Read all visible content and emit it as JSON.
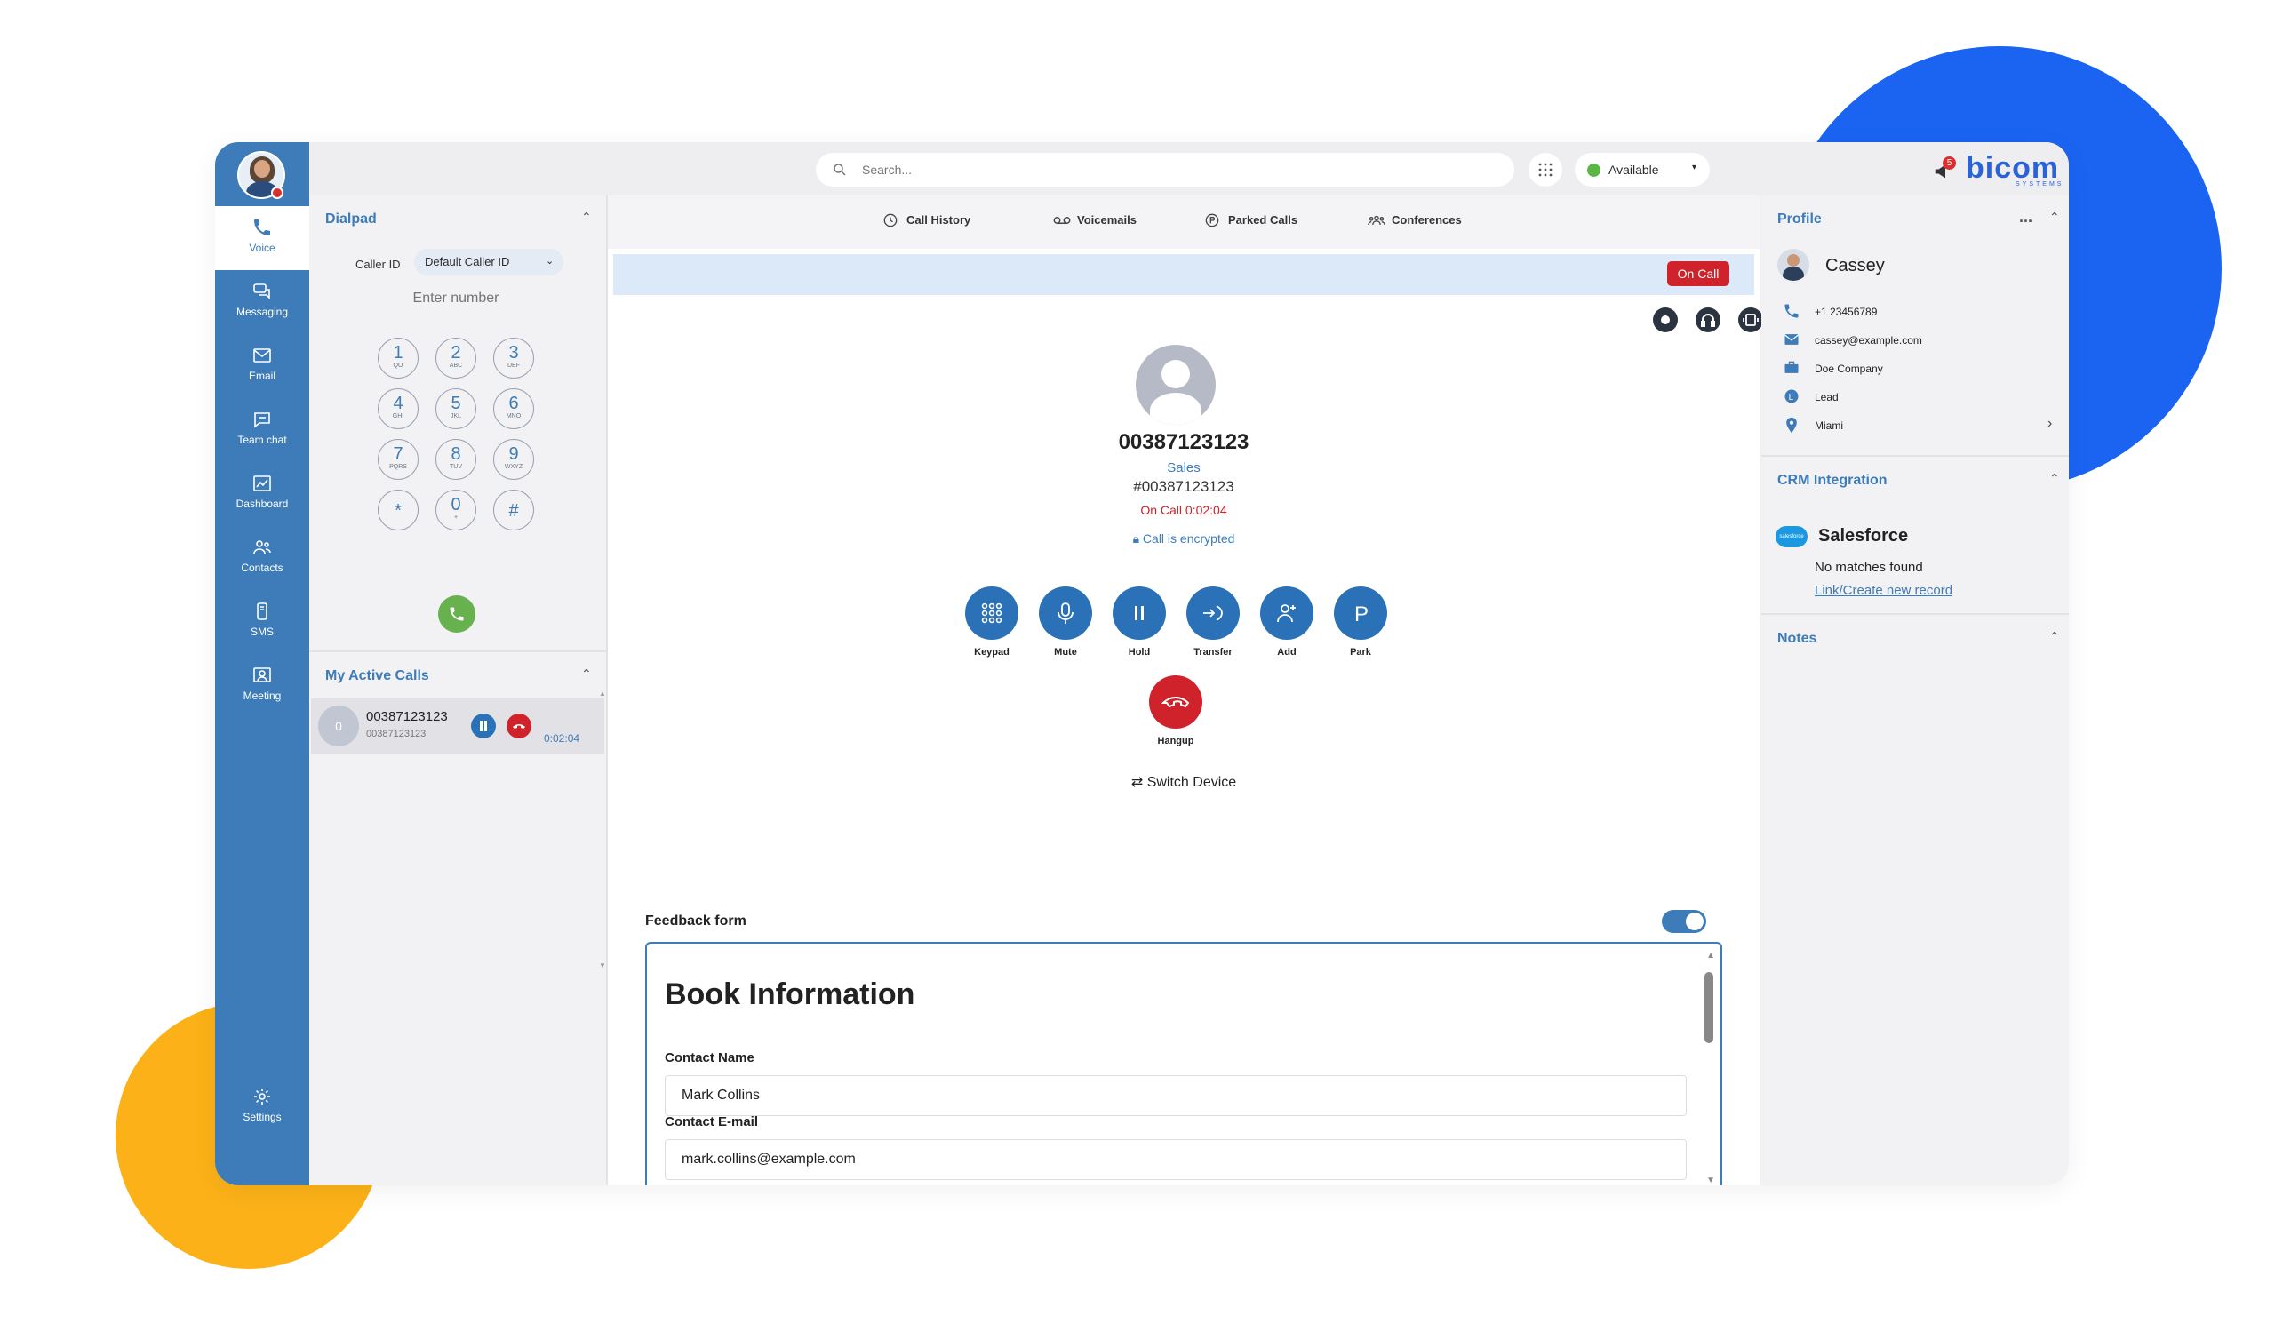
{
  "brand": {
    "logo": "bicom",
    "logo_sub": "SYSTEMS",
    "accent": "#3d7cb8",
    "danger": "#d0222a",
    "success": "#67b24e"
  },
  "topbar": {
    "search_placeholder": "Search...",
    "status_label": "Available",
    "notification_count": "5"
  },
  "nav": {
    "items": [
      {
        "label": "Voice",
        "icon": "phone-icon"
      },
      {
        "label": "Messaging",
        "icon": "chat-bubbles-icon"
      },
      {
        "label": "Email",
        "icon": "envelope-icon"
      },
      {
        "label": "Team chat",
        "icon": "chat-bubble-icon"
      },
      {
        "label": "Dashboard",
        "icon": "chart-icon"
      },
      {
        "label": "Contacts",
        "icon": "people-icon"
      },
      {
        "label": "SMS",
        "icon": "mobile-icon"
      },
      {
        "label": "Meeting",
        "icon": "video-meeting-icon"
      }
    ],
    "settings_label": "Settings"
  },
  "dialpad": {
    "title": "Dialpad",
    "caller_id_label": "Caller ID",
    "caller_id_value": "Default Caller ID",
    "number_placeholder": "Enter number",
    "keys": [
      {
        "digit": "1",
        "letters": "QO"
      },
      {
        "digit": "2",
        "letters": "ABC"
      },
      {
        "digit": "3",
        "letters": "DEF"
      },
      {
        "digit": "4",
        "letters": "GHI"
      },
      {
        "digit": "5",
        "letters": "JKL"
      },
      {
        "digit": "6",
        "letters": "MNO"
      },
      {
        "digit": "7",
        "letters": "PQRS"
      },
      {
        "digit": "8",
        "letters": "TUV"
      },
      {
        "digit": "9",
        "letters": "WXYZ"
      },
      {
        "digit": "*",
        "letters": ""
      },
      {
        "digit": "0",
        "letters": "+"
      },
      {
        "digit": "#",
        "letters": ""
      }
    ]
  },
  "active_calls": {
    "title": "My Active Calls",
    "items": [
      {
        "avatar": "0",
        "number": "00387123123",
        "sub": "00387123123",
        "time": "0:02:04"
      }
    ]
  },
  "tabs": [
    {
      "label": "Call History",
      "icon": "clock-icon"
    },
    {
      "label": "Voicemails",
      "icon": "voicemail-icon"
    },
    {
      "label": "Parked Calls",
      "icon": "parking-icon"
    },
    {
      "label": "Conferences",
      "icon": "group-icon"
    }
  ],
  "call": {
    "badge": "On Call",
    "number": "00387123123",
    "department": "Sales",
    "hash_number": "#00387123123",
    "status": "On Call 0:02:04",
    "encrypted": "Call is encrypted",
    "actions": [
      {
        "label": "Keypad",
        "icon": "keypad-icon"
      },
      {
        "label": "Mute",
        "icon": "microphone-icon"
      },
      {
        "label": "Hold",
        "icon": "pause-icon"
      },
      {
        "label": "Transfer",
        "icon": "transfer-icon"
      },
      {
        "label": "Add",
        "icon": "add-person-icon"
      },
      {
        "label": "Park",
        "icon": "park-icon"
      }
    ],
    "hangup_label": "Hangup",
    "switch_device": "Switch Device"
  },
  "feedback": {
    "title": "Feedback form",
    "enabled": true,
    "form_title": "Book Information",
    "fields": [
      {
        "label": "Contact Name",
        "value": "Mark Collins"
      },
      {
        "label": "Contact E-mail",
        "value": "mark.collins@example.com"
      }
    ]
  },
  "profile": {
    "title": "Profile",
    "more": "...",
    "name": "Cassey",
    "phone": "+1 23456789",
    "email": "cassey@example.com",
    "company": "Doe Company",
    "type": "Lead",
    "location": "Miami"
  },
  "crm": {
    "title": "CRM Integration",
    "provider": "Salesforce",
    "provider_badge": "salesforce",
    "message": "No matches found",
    "link": "Link/Create new record"
  },
  "notes": {
    "title": "Notes"
  }
}
